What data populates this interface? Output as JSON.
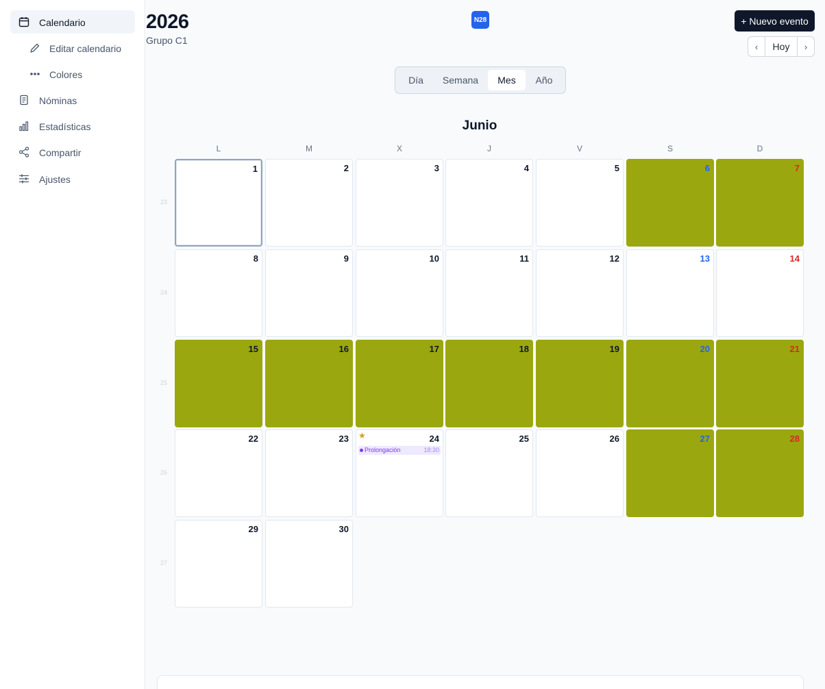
{
  "sidebar": {
    "items": [
      {
        "label": "Calendario",
        "icon": "calendar-icon",
        "active": true
      },
      {
        "label": "Editar calendario",
        "icon": "pencil-icon",
        "sub": true
      },
      {
        "label": "Colores",
        "icon": "dots-icon",
        "sub": true
      },
      {
        "label": "Nóminas",
        "icon": "document-icon"
      },
      {
        "label": "Estadísticas",
        "icon": "bar-chart-icon"
      },
      {
        "label": "Compartir",
        "icon": "share-icon"
      },
      {
        "label": "Ajustes",
        "icon": "sliders-icon"
      }
    ]
  },
  "header": {
    "year": "2026",
    "group": "Grupo C1",
    "week_badge": "N28",
    "new_event": "+ Nuevo evento",
    "prev": "‹",
    "today": "Hoy",
    "next": "›"
  },
  "views": [
    "Día",
    "Semana",
    "Mes",
    "Año"
  ],
  "active_view": "Mes",
  "calendar": {
    "month": "Junio",
    "weekdays": [
      "L",
      "M",
      "X",
      "J",
      "V",
      "S",
      "D"
    ],
    "week_numbers": [
      "23",
      "24",
      "25",
      "26",
      "27"
    ],
    "highlight_color": "#9ba70f",
    "saturday_color": "#2563eb",
    "sunday_color": "#dc2626",
    "weeks": [
      [
        {
          "d": "1",
          "today": true
        },
        {
          "d": "2"
        },
        {
          "d": "3"
        },
        {
          "d": "4"
        },
        {
          "d": "5"
        },
        {
          "d": "6",
          "hl": true
        },
        {
          "d": "7",
          "hl": true
        }
      ],
      [
        {
          "d": "8"
        },
        {
          "d": "9"
        },
        {
          "d": "10"
        },
        {
          "d": "11"
        },
        {
          "d": "12"
        },
        {
          "d": "13"
        },
        {
          "d": "14"
        }
      ],
      [
        {
          "d": "15",
          "hl": true
        },
        {
          "d": "16",
          "hl": true
        },
        {
          "d": "17",
          "hl": true
        },
        {
          "d": "18",
          "hl": true
        },
        {
          "d": "19",
          "hl": true
        },
        {
          "d": "20",
          "hl": true
        },
        {
          "d": "21",
          "hl": true
        }
      ],
      [
        {
          "d": "22"
        },
        {
          "d": "23"
        },
        {
          "d": "24",
          "star": "★",
          "event": {
            "name": "Prolongación",
            "time": "18:30"
          }
        },
        {
          "d": "25"
        },
        {
          "d": "26"
        },
        {
          "d": "27",
          "hl": true
        },
        {
          "d": "28",
          "hl": true
        }
      ],
      [
        {
          "d": "29"
        },
        {
          "d": "30"
        }
      ]
    ]
  }
}
